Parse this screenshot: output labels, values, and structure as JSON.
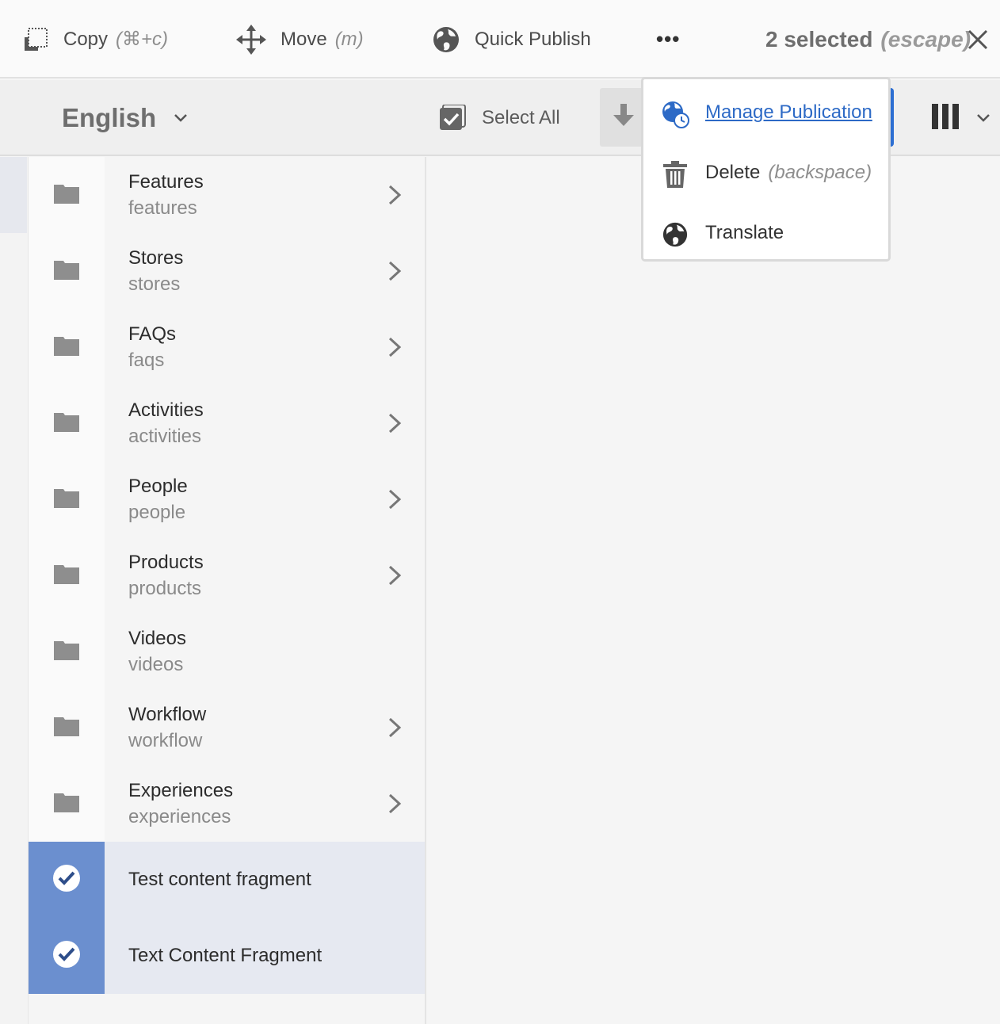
{
  "actionbar": {
    "copy": {
      "label": "Copy",
      "shortcut": "(⌘+c)",
      "icon": "copy-icon"
    },
    "move": {
      "label": "Move",
      "shortcut": "(m)",
      "icon": "move-icon"
    },
    "quick_publish": {
      "label": "Quick Publish",
      "icon": "globe-icon"
    },
    "more": {
      "label": "•••",
      "icon": "more-icon"
    },
    "selected": {
      "count_label": "2 selected",
      "shortcut": "(escape)"
    },
    "close_icon": "close-icon"
  },
  "titlebar": {
    "language": "English",
    "select_all": "Select All",
    "download_icon": "download-icon",
    "view_icon": "column-view-icon"
  },
  "popover": {
    "items": [
      {
        "label": "Manage Publication",
        "icon": "globe-clock-icon"
      },
      {
        "label": "Delete",
        "shortcut": "(backspace)",
        "icon": "trash-icon"
      },
      {
        "label": "Translate",
        "icon": "globe-icon"
      }
    ]
  },
  "column": {
    "folders": [
      {
        "title": "Features",
        "name": "features",
        "has_children": true
      },
      {
        "title": "Stores",
        "name": "stores",
        "has_children": true
      },
      {
        "title": "FAQs",
        "name": "faqs",
        "has_children": true
      },
      {
        "title": "Activities",
        "name": "activities",
        "has_children": true
      },
      {
        "title": "People",
        "name": "people",
        "has_children": true
      },
      {
        "title": "Products",
        "name": "products",
        "has_children": true
      },
      {
        "title": "Videos",
        "name": "videos",
        "has_children": false
      },
      {
        "title": "Workflow",
        "name": "workflow",
        "has_children": true
      },
      {
        "title": "Experiences",
        "name": "experiences",
        "has_children": true
      }
    ],
    "selected_items": [
      {
        "title": "Test content fragment"
      },
      {
        "title": "Text Content Fragment"
      }
    ]
  },
  "colors": {
    "accent": "#2d6ac6",
    "selected_thumb": "#6b8fcf",
    "selected_row": "#e6e9f1"
  }
}
